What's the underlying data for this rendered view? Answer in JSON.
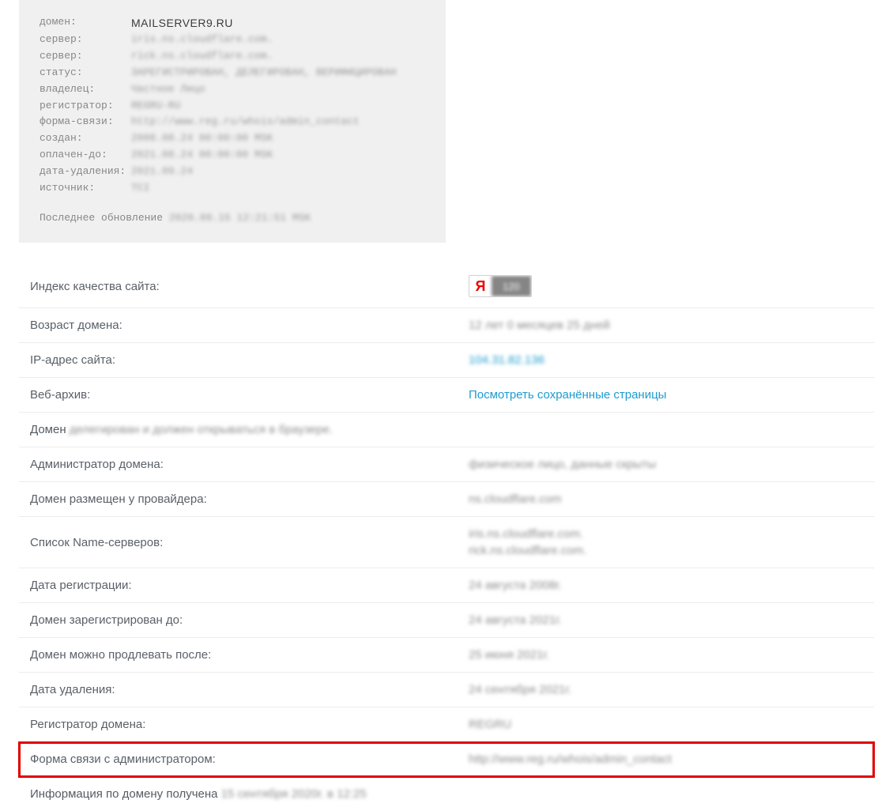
{
  "whois": {
    "rows": [
      {
        "label": "домен:",
        "value": "MAILSERVER9.RU",
        "clear": true
      },
      {
        "label": "сервер:",
        "value": "iris.ns.cloudflare.com."
      },
      {
        "label": "сервер:",
        "value": "rick.ns.cloudflare.com."
      },
      {
        "label": "статус:",
        "value": "ЗАРЕГИСТРИРОВАН, ДЕЛЕГИРОВАН, ВЕРИФИЦИРОВАН"
      },
      {
        "label": "владелец:",
        "value": "Частное Лицо"
      },
      {
        "label": "регистратор:",
        "value": "REGRU-RU"
      },
      {
        "label": "форма-связи:",
        "value": "http://www.reg.ru/whois/admin_contact"
      },
      {
        "label": "создан:",
        "value": "2008.08.24 00:00:00 MSK"
      },
      {
        "label": "оплачен-до:",
        "value": "2021.08.24 00:00:00 MSK"
      },
      {
        "label": "дата-удаления:",
        "value": "2021.09.24"
      },
      {
        "label": "источник:",
        "value": "TCI"
      }
    ],
    "footer_label": "Последнее обновление ",
    "footer_value": "2020.09.15 12:21:51 MSK"
  },
  "yandex": {
    "letter": "Я",
    "score": "120"
  },
  "info": [
    {
      "label": "Индекс качества сайта:",
      "type": "yandex"
    },
    {
      "label": "Возраст домена:",
      "value": "12 лет 0 месяцев 25 дней",
      "blur": true
    },
    {
      "label": "IP-адрес сайта:",
      "value": "104.31.82.136",
      "blur": true,
      "link": true
    },
    {
      "label": "Веб-архив:",
      "value": "Посмотреть сохранённые страницы",
      "link": true
    },
    {
      "label": "Домен ",
      "inline_value": "делегирован и должен открываться в браузере.",
      "fullrow": true
    },
    {
      "label": "Администратор домена:",
      "value": "физическое лицо, данные скрыты",
      "blur": true
    },
    {
      "label": "Домен размещен у провайдера:",
      "value": "ns.cloudflare.com",
      "blur": true
    },
    {
      "label": "Список Name-серверов:",
      "value": "iris.ns.cloudflare.com.",
      "value2": "rick.ns.cloudflare.com.",
      "blur": true
    },
    {
      "label": "Дата регистрации:",
      "value": "24 августа 2008г.",
      "blur": true
    },
    {
      "label": "Домен зарегистрирован до:",
      "value": "24 августа 2021г.",
      "blur": true
    },
    {
      "label": "Домен можно продлевать после:",
      "value": "25 июня 2021г.",
      "blur": true
    },
    {
      "label": "Дата удаления:",
      "value": "24 сентября 2021г.",
      "blur": true
    },
    {
      "label": "Регистратор домена:",
      "value": "REGRU",
      "blur": true
    },
    {
      "label": "Форма связи с администратором:",
      "value": "http://www.reg.ru/whois/admin_contact",
      "blur": true,
      "highlight": true
    },
    {
      "label": "Информация по домену получена ",
      "inline_value": "15 сентября 2020г. в 12:25",
      "fullrow": true
    }
  ]
}
